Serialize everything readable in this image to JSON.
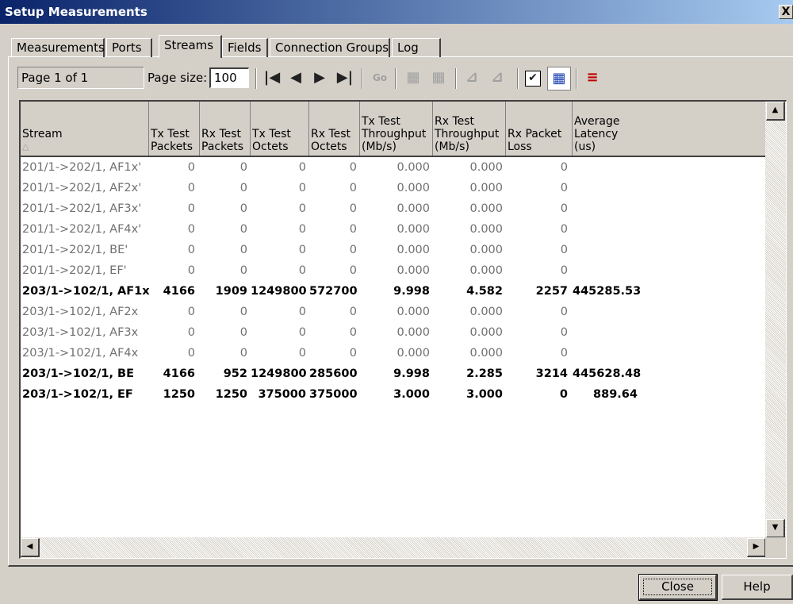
{
  "window": {
    "title": "Setup Measurements",
    "close_glyph": "X"
  },
  "tabs": [
    {
      "label": "Measurements"
    },
    {
      "label": "Ports"
    },
    {
      "label": "Streams"
    },
    {
      "label": "Fields"
    },
    {
      "label": "Connection Groups"
    },
    {
      "label": "Log"
    }
  ],
  "active_tab": "Streams",
  "toolbar": {
    "page_info": "Page 1 of 1",
    "page_size_label": "Page size:",
    "page_size_value": "100",
    "go_label": "Go",
    "icons": [
      "first-page-icon",
      "prev-page-icon",
      "next-page-icon",
      "last-page-icon",
      "go-icon",
      "add-columns-icon",
      "remove-columns-icon",
      "add-chart-icon",
      "remove-chart-icon",
      "checkbox-icon",
      "grid-view-icon",
      "list-view-icon"
    ]
  },
  "table": {
    "columns": [
      {
        "lines": [
          "Stream"
        ]
      },
      {
        "lines": [
          "Tx Test",
          "Packets"
        ]
      },
      {
        "lines": [
          "Rx Test",
          "Packets"
        ]
      },
      {
        "lines": [
          "Tx Test",
          "Octets"
        ]
      },
      {
        "lines": [
          "Rx Test",
          "Octets"
        ]
      },
      {
        "lines": [
          "Tx Test",
          "Throughput",
          "(Mb/s)"
        ]
      },
      {
        "lines": [
          "Rx Test",
          "Throughput",
          "(Mb/s)"
        ]
      },
      {
        "lines": [
          "Rx Packet",
          "Loss"
        ]
      },
      {
        "lines": [
          "Average",
          "Latency",
          "(us)"
        ]
      }
    ],
    "rows": [
      {
        "active": false,
        "cells": [
          "201/1->202/1, AF1x'",
          "0",
          "0",
          "0",
          "0",
          "0.000",
          "0.000",
          "0",
          ""
        ]
      },
      {
        "active": false,
        "cells": [
          "201/1->202/1, AF2x'",
          "0",
          "0",
          "0",
          "0",
          "0.000",
          "0.000",
          "0",
          ""
        ]
      },
      {
        "active": false,
        "cells": [
          "201/1->202/1, AF3x'",
          "0",
          "0",
          "0",
          "0",
          "0.000",
          "0.000",
          "0",
          ""
        ]
      },
      {
        "active": false,
        "cells": [
          "201/1->202/1, AF4x'",
          "0",
          "0",
          "0",
          "0",
          "0.000",
          "0.000",
          "0",
          ""
        ]
      },
      {
        "active": false,
        "cells": [
          "201/1->202/1, BE'",
          "0",
          "0",
          "0",
          "0",
          "0.000",
          "0.000",
          "0",
          ""
        ]
      },
      {
        "active": false,
        "cells": [
          "201/1->202/1, EF'",
          "0",
          "0",
          "0",
          "0",
          "0.000",
          "0.000",
          "0",
          ""
        ]
      },
      {
        "active": true,
        "cells": [
          "203/1->102/1, AF1x",
          "4166",
          "1909",
          "1249800",
          "572700",
          "9.998",
          "4.582",
          "2257",
          "445285.53"
        ]
      },
      {
        "active": false,
        "cells": [
          "203/1->102/1, AF2x",
          "0",
          "0",
          "0",
          "0",
          "0.000",
          "0.000",
          "0",
          ""
        ]
      },
      {
        "active": false,
        "cells": [
          "203/1->102/1, AF3x",
          "0",
          "0",
          "0",
          "0",
          "0.000",
          "0.000",
          "0",
          ""
        ]
      },
      {
        "active": false,
        "cells": [
          "203/1->102/1, AF4x",
          "0",
          "0",
          "0",
          "0",
          "0.000",
          "0.000",
          "0",
          ""
        ]
      },
      {
        "active": true,
        "cells": [
          "203/1->102/1, BE",
          "4166",
          "952",
          "1249800",
          "285600",
          "9.998",
          "2.285",
          "3214",
          "445628.48"
        ]
      },
      {
        "active": true,
        "cells": [
          "203/1->102/1, EF",
          "1250",
          "1250",
          "375000",
          "375000",
          "3.000",
          "3.000",
          "0",
          "889.64"
        ]
      }
    ]
  },
  "buttons": {
    "close": "Close",
    "help": "Help"
  }
}
